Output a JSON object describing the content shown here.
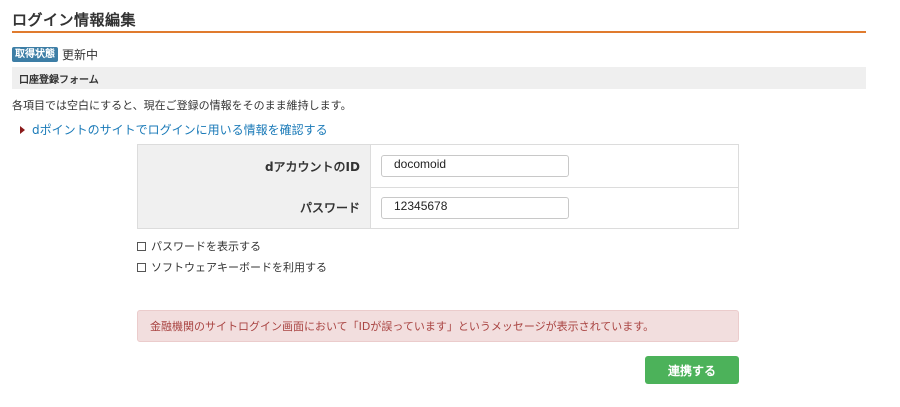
{
  "page": {
    "title": "ログイン情報編集"
  },
  "status": {
    "badge": "取得状態",
    "text": "更新中"
  },
  "section": {
    "header": "口座登録フォーム"
  },
  "instructions": "各項目では空白にすると、現在ご登録の情報をそのまま維持します。",
  "info_link": {
    "label": "dポイントのサイトでログインに用いる情報を確認する"
  },
  "form": {
    "account_id": {
      "label": "dアカウントのID",
      "value": "docomoid"
    },
    "password": {
      "label": "パスワード",
      "value": "12345678"
    }
  },
  "options": {
    "show_password": "パスワードを表示する",
    "software_keyboard": "ソフトウェアキーボードを利用する"
  },
  "error": {
    "message": "金融機関のサイトログイン画面において「IDが誤っています」というメッセージが表示されています。"
  },
  "actions": {
    "submit_label": "連携する"
  },
  "colors": {
    "accent_rule": "#e07b2e",
    "badge": "#3d7ea6",
    "link": "#1a7ab8",
    "error_bg": "#f2dede",
    "error_text": "#a94442",
    "submit_bg": "#4cb25a"
  }
}
